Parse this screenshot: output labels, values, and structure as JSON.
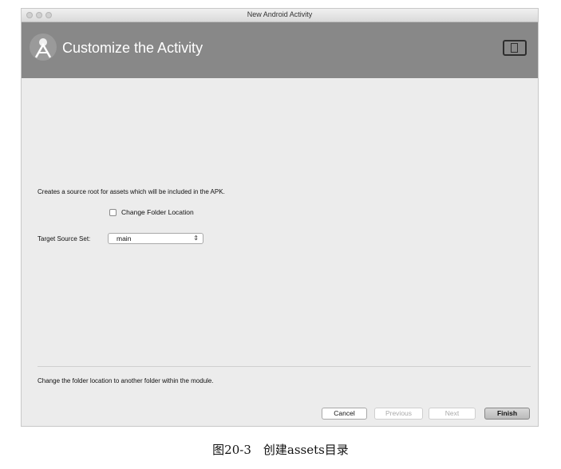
{
  "window": {
    "title": "New Android Activity"
  },
  "header": {
    "title": "Customize the Activity",
    "logo_icon": "android-studio-logo",
    "device_icon": "tablet-device-icon"
  },
  "form": {
    "description": "Creates a source root for assets which will be included in the APK.",
    "change_folder_label": "Change Folder Location",
    "change_folder_checked": false,
    "target_source_set_label": "Target Source Set:",
    "target_source_set_value": "main",
    "select_arrows": "⇕"
  },
  "footer": {
    "help_text": "Change the folder location to another folder within the module.",
    "cancel_label": "Cancel",
    "previous_label": "Previous",
    "next_label": "Next",
    "finish_label": "Finish"
  },
  "caption": "图20-3　创建assets目录"
}
